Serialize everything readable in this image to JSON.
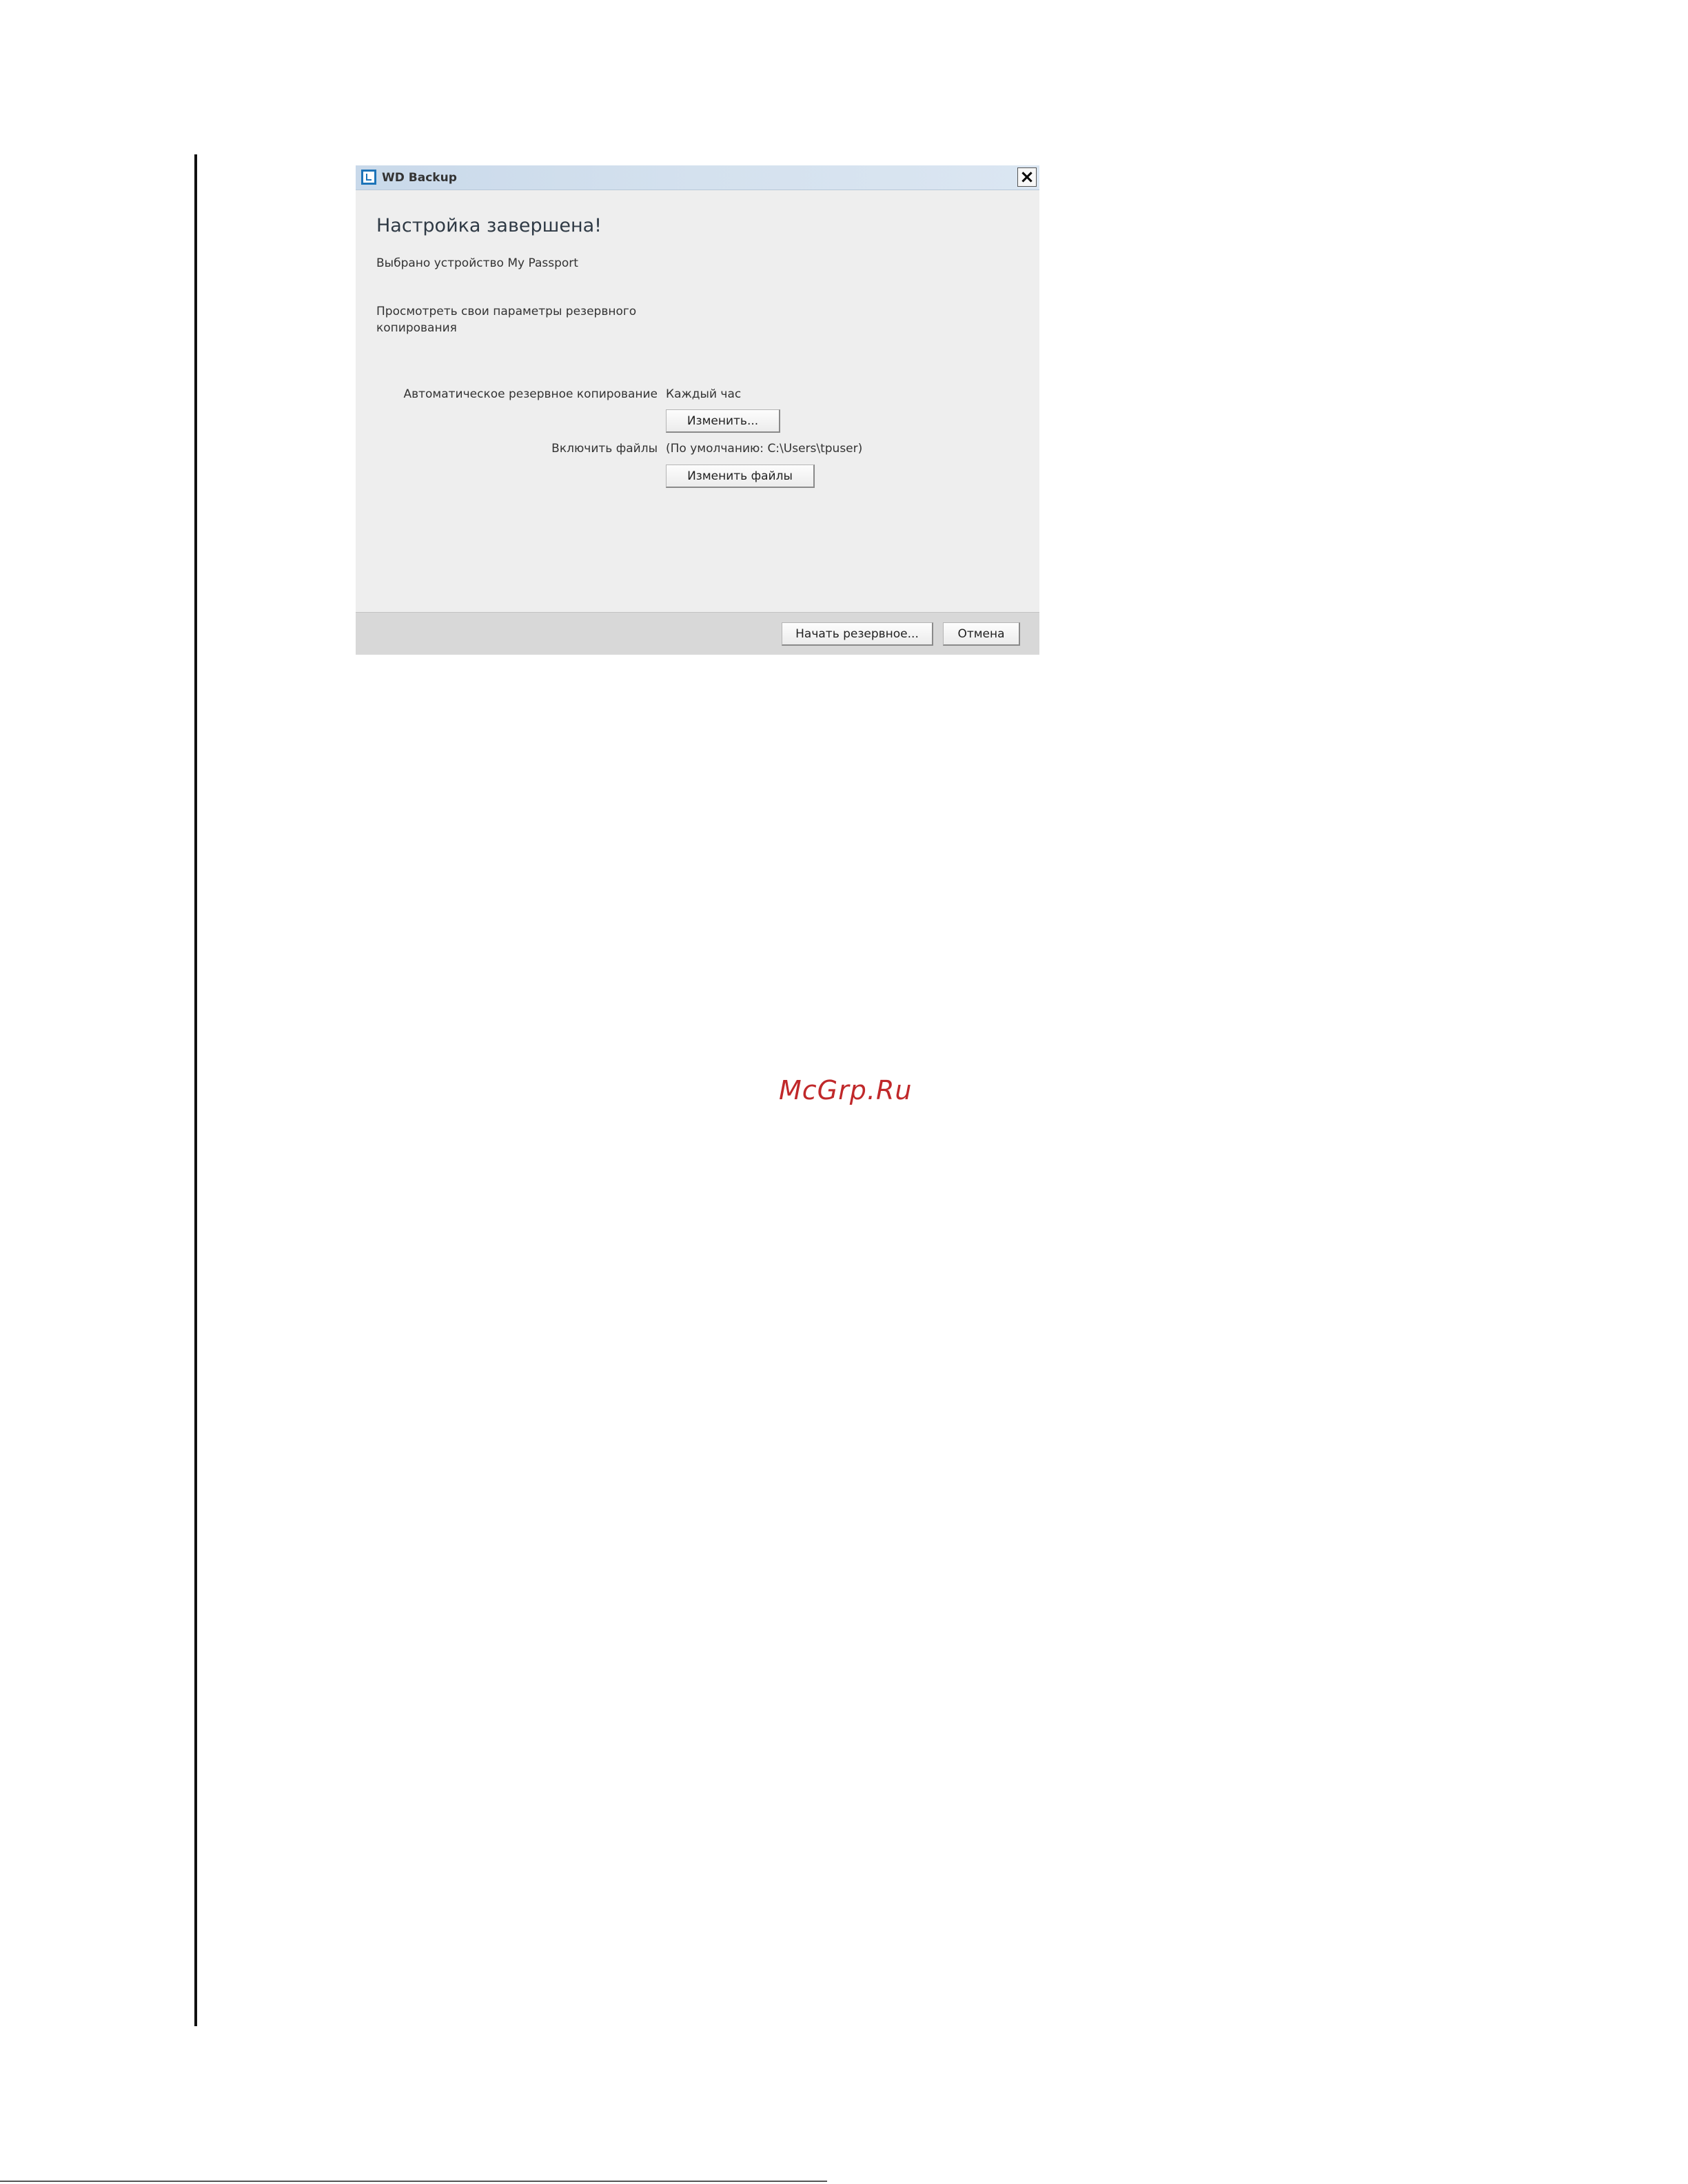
{
  "window": {
    "title": "WD Backup",
    "close_glyph": "✕",
    "icon": "wd-backup-app-icon"
  },
  "content": {
    "heading": "Настройка завершена!",
    "device_selected": "Выбрано устройство My Passport",
    "review_settings": "Просмотреть свои параметры резервного копирования"
  },
  "settings": {
    "auto_backup_label": "Автоматическое резервное копирование",
    "auto_backup_value": "Каждый час",
    "change_button": "Изменить...",
    "include_files_label": "Включить файлы",
    "include_files_value": "(По умолчанию: C:\\Users\\tpuser)",
    "change_files_button": "Изменить файлы"
  },
  "footer": {
    "start_button": "Начать резервное...",
    "cancel_button": "Отмена"
  },
  "watermark": "McGrp.Ru",
  "colors": {
    "titlebar": "#c9d9ea",
    "dialog_bg": "#eeeeee",
    "footer_bg": "#d8d8d8",
    "watermark": "#c0282a",
    "icon_accent": "#1d74b8"
  }
}
